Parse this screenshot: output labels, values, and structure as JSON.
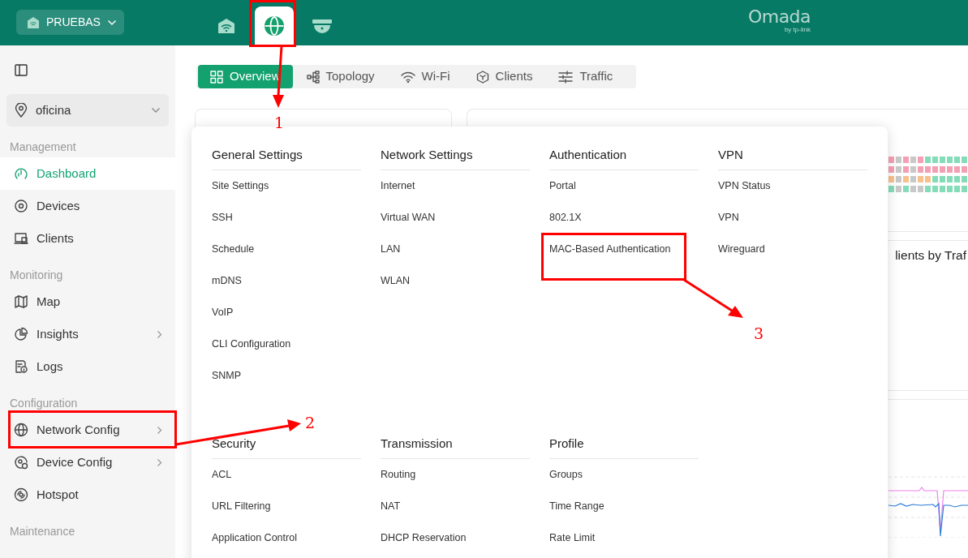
{
  "header": {
    "site": "PRUEBAS",
    "app_tabs": [
      {
        "kind": "wireless",
        "selected": false
      },
      {
        "kind": "network",
        "selected": true
      },
      {
        "kind": "camera",
        "selected": false
      }
    ],
    "logo": {
      "name": "Omada",
      "byline": "by tp-link"
    }
  },
  "sidebar": {
    "site_selector": "oficina",
    "sections": [
      {
        "title": "Management",
        "items": [
          {
            "label": "Dashboard",
            "kind": "dashboard",
            "selected": true,
            "submenu": false
          },
          {
            "label": "Devices",
            "kind": "devices",
            "selected": false,
            "submenu": false
          },
          {
            "label": "Clients",
            "kind": "clients",
            "selected": false,
            "submenu": false
          }
        ]
      },
      {
        "title": "Monitoring",
        "items": [
          {
            "label": "Map",
            "kind": "map",
            "selected": false,
            "submenu": false
          },
          {
            "label": "Insights",
            "kind": "insights",
            "selected": false,
            "submenu": true
          },
          {
            "label": "Logs",
            "kind": "logs",
            "selected": false,
            "submenu": false
          }
        ]
      },
      {
        "title": "Configuration",
        "items": [
          {
            "label": "Network Config",
            "kind": "network",
            "selected": false,
            "submenu": true
          },
          {
            "label": "Device Config",
            "kind": "device-config",
            "selected": false,
            "submenu": true
          },
          {
            "label": "Hotspot",
            "kind": "hotspot",
            "selected": false,
            "submenu": false
          }
        ]
      },
      {
        "title": "Maintenance"
      }
    ]
  },
  "view_tabs": [
    {
      "label": "Overview",
      "kind": "grid",
      "selected": true
    },
    {
      "label": "Topology",
      "kind": "topology",
      "selected": false
    },
    {
      "label": "Wi-Fi",
      "kind": "wifi",
      "selected": false
    },
    {
      "label": "Clients",
      "kind": "cube",
      "selected": false
    },
    {
      "label": "Traffic",
      "kind": "sliders",
      "selected": false
    }
  ],
  "background": {
    "partial_title": "lients by Traf",
    "uptime_grid": [
      [
        {
          "color": "#f4a0b4"
        },
        {
          "color": "#c8c8c8"
        },
        {
          "color": "#f4a0b4"
        },
        {
          "color": "#c8c8c8"
        },
        {
          "color": "#f4a0b4"
        },
        {
          "color": "#84dcb8"
        },
        {
          "color": "#84dcb8"
        },
        {
          "color": "#84dcb8"
        },
        {
          "color": "#84dcb8"
        },
        {
          "color": "#84dcb8"
        },
        {
          "color": "#84dcb8"
        }
      ],
      [
        {
          "color": "#f4a0b4"
        },
        {
          "color": "#c8c8c8"
        },
        {
          "color": "#f4a0b4"
        },
        {
          "color": "#c8c8c8"
        },
        {
          "color": "#f4a0b4"
        },
        {
          "color": "#f4a0b4"
        },
        {
          "color": "#f4a0b4"
        },
        {
          "color": "#f4a0b4"
        },
        {
          "color": "#f4a0b4"
        },
        {
          "color": "#f4a0b4"
        },
        {
          "color": "#f4a0b4"
        }
      ],
      [
        {
          "color": "#f8c08c"
        },
        {
          "color": "#c8c8c8"
        },
        {
          "color": "#f8c08c"
        },
        {
          "color": "#c8c8c8"
        },
        {
          "color": "#f8c08c"
        },
        {
          "color": "#f8c08c"
        },
        {
          "color": "#84dcb8"
        },
        {
          "color": "#84dcb8"
        },
        {
          "color": "#84dcb8"
        },
        {
          "color": "#84dcb8"
        },
        {
          "color": "#84dcb8"
        }
      ],
      [
        {
          "color": "#84dcb8"
        },
        {
          "color": "#c8c8c8"
        },
        {
          "color": "#84dcb8"
        },
        {
          "color": "#c8c8c8"
        },
        {
          "color": "#c8c8c8"
        },
        {
          "color": "#84dcb8"
        },
        {
          "color": "#84dcb8"
        },
        {
          "color": "#84dcb8"
        },
        {
          "color": "#84dcb8"
        },
        {
          "color": "#84dcb8"
        },
        {
          "color": "#84dcb8"
        }
      ]
    ]
  },
  "menu": {
    "rows": [
      [
        {
          "title": "General Settings",
          "items": [
            "Site Settings",
            "SSH",
            "Schedule",
            "mDNS",
            "VoIP",
            "CLI Configuration",
            "SNMP"
          ]
        },
        {
          "title": "Network Settings",
          "items": [
            "Internet",
            "Virtual WAN",
            "LAN",
            "WLAN"
          ]
        },
        {
          "title": "Authentication",
          "items": [
            "Portal",
            "802.1X",
            "MAC-Based Authentication"
          ]
        },
        {
          "title": "VPN",
          "items": [
            "VPN Status",
            "VPN",
            "Wireguard"
          ]
        }
      ],
      [
        {
          "title": "Security",
          "items": [
            "ACL",
            "URL Filtering",
            "Application Control"
          ]
        },
        {
          "title": "Transmission",
          "items": [
            "Routing",
            "NAT",
            "DHCP Reservation"
          ]
        },
        {
          "title": "Profile",
          "items": [
            "Groups",
            "Time Range",
            "Rate Limit"
          ]
        }
      ]
    ]
  },
  "annotations": [
    {
      "label": "1"
    },
    {
      "label": "2"
    },
    {
      "label": "3"
    }
  ]
}
